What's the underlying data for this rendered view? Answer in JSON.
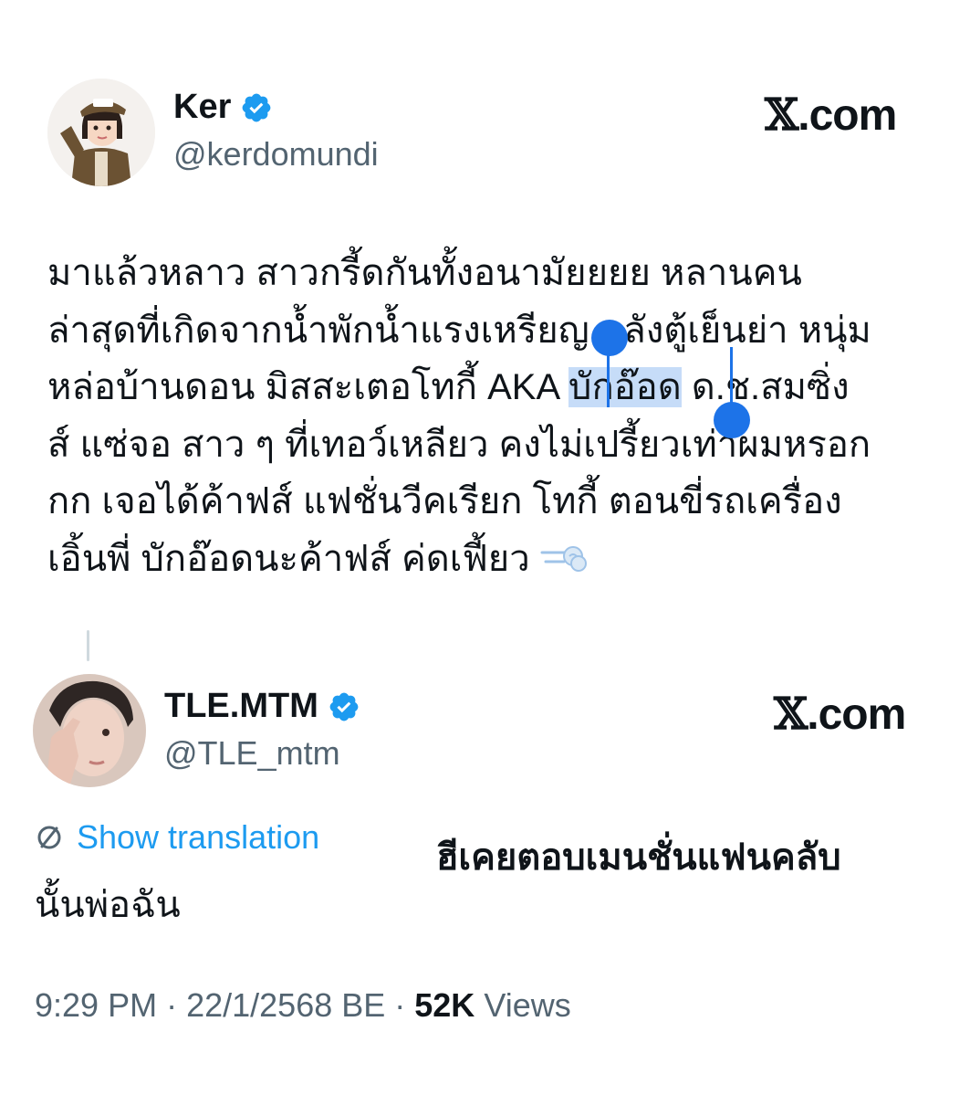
{
  "tweet1": {
    "display_name": "Ker",
    "handle": "@kerdomundi",
    "badge": "verified-badge",
    "site_label": ".com",
    "lines": [
      "มาแล้วหลาว สาวกรี้ดกันทั้งอนามัยยยย หลานคน",
      "ล่าสุดที่เกิดจากน้ำพักน้ำแรงเหรียญ หลังตู้เย็นย่า หนุ่ม",
      "หล่อบ้านดอน มิสสะเตอโทกี้ AKA ",
      "บักอ๊อด",
      " ด.ช.สมซิ่ง",
      "ส์ แซ่จอ สาว ๆ ที่เทอว์เหลียว คงไม่เปรี้ยวเท่าผมหรอก",
      "กก เจอได้ค้าฟส์ แฟชั่นวีคเรียก โทกี้ ตอนขี่รถเครื่อง",
      "เอิ้นพี่ บักอ๊อดนะค้าฟส์ ค่ดเฟี้ยว"
    ],
    "emoji": "dashing-away-emoji"
  },
  "tweet2": {
    "display_name": "TLE.MTM",
    "handle": "@TLE_mtm",
    "badge": "verified-badge",
    "site_label": ".com",
    "show_translation": "Show translation",
    "caption": "ฮีเคยตอบเมนชั่นแฟนคลับ",
    "text": "นั้นพ่อฉัน",
    "time": "9:29 PM",
    "separator": "·",
    "date": "22/1/2568 BE",
    "views_count": "52K",
    "views_label": "Views"
  },
  "colors": {
    "verified": "#1d9bf0",
    "link": "#1d9bf0",
    "selection_handle": "#1d73e8",
    "muted": "#536471"
  }
}
